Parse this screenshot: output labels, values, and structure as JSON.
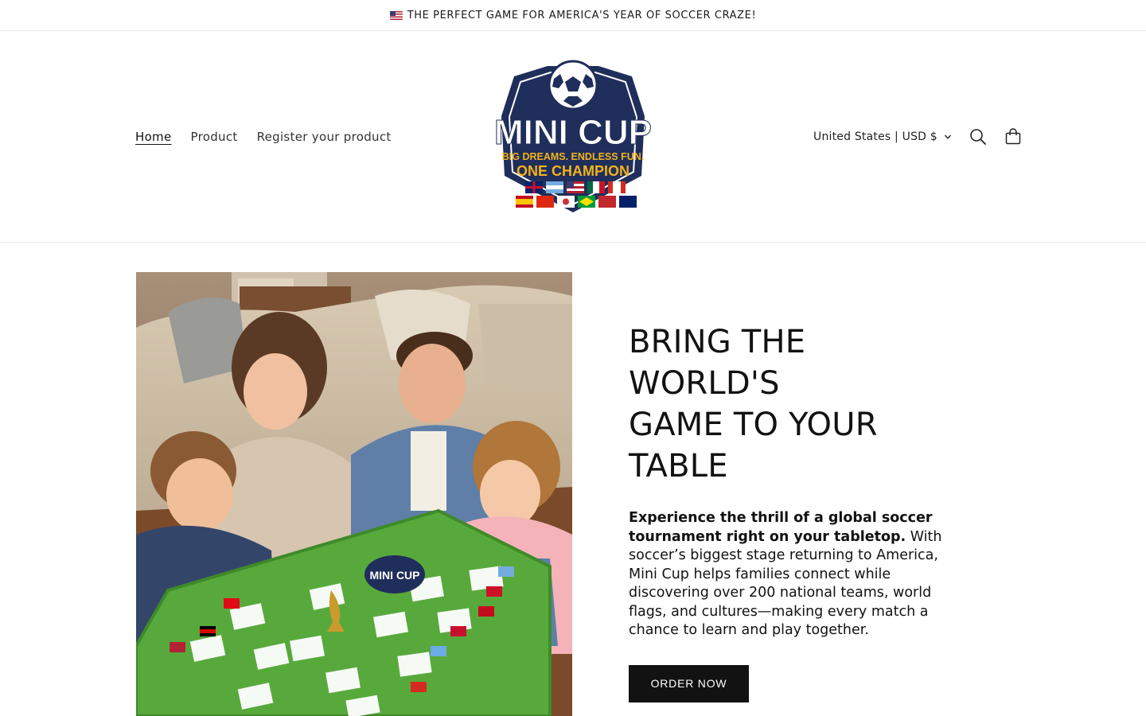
{
  "announcement": {
    "text": "THE PERFECT GAME FOR AMERICA'S YEAR OF SOCCER CRAZE!",
    "icon": "us-flag-icon"
  },
  "nav": {
    "items": [
      {
        "label": "Home",
        "active": true
      },
      {
        "label": "Product",
        "active": false
      },
      {
        "label": "Register your product",
        "active": false
      }
    ]
  },
  "logo": {
    "title": "MINI CUP",
    "tagline_1": "BIG DREAMS. ENDLESS FUN.",
    "tagline_2": "ONE CHAMPION"
  },
  "header_tools": {
    "currency": "United States | USD $",
    "search_icon": "search-icon",
    "cart_icon": "cart-icon"
  },
  "hero": {
    "title_line1": "BRING THE WORLD'S",
    "title_line2": "GAME TO YOUR TABLE",
    "desc_bold": "Experience the thrill of a global soccer tournament right on your tabletop.",
    "desc_rest": " With soccer’s biggest stage returning to America, Mini Cup helps families connect while discovering over 200 national teams, world flags, and cultures—making every match a chance to learn and play together.",
    "cta": "ORDER NOW",
    "image_board_logo": "MINI CUP"
  },
  "colors": {
    "navy": "#1f2e5a",
    "gold": "#f2b21b",
    "felt_green": "#58a93c",
    "button_bg": "#121212"
  }
}
